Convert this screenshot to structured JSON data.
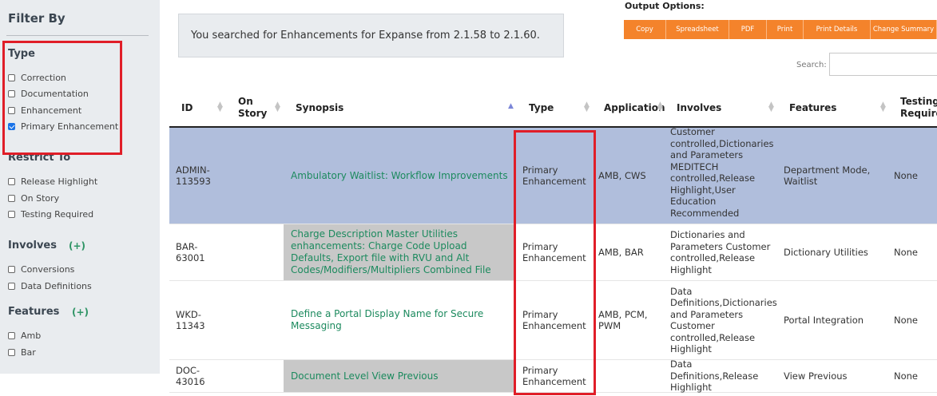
{
  "sidebar": {
    "title": "Filter By",
    "type_section": {
      "heading": "Type",
      "options": [
        {
          "label": "Correction",
          "checked": false
        },
        {
          "label": "Documentation",
          "checked": false
        },
        {
          "label": "Enhancement",
          "checked": false
        },
        {
          "label": "Primary Enhancement",
          "checked": true
        }
      ]
    },
    "restrict_section": {
      "heading": "Restrict To",
      "options": [
        {
          "label": "Release Highlight",
          "checked": false
        },
        {
          "label": "On Story",
          "checked": false
        },
        {
          "label": "Testing Required",
          "checked": false
        }
      ]
    },
    "involves_section": {
      "heading": "Involves",
      "expand": "(+)",
      "options": [
        {
          "label": "Conversions",
          "checked": false
        },
        {
          "label": "Data Definitions",
          "checked": false
        }
      ]
    },
    "features_section": {
      "heading": "Features",
      "expand": "(+)",
      "options": [
        {
          "label": "Amb",
          "checked": false
        },
        {
          "label": "Bar",
          "checked": false
        }
      ]
    }
  },
  "summary": {
    "text": "You searched for Enhancements for Expanse from 2.1.58 to 2.1.60."
  },
  "output": {
    "title": "Output Options:",
    "buttons": [
      "Copy",
      "Spreadsheet",
      "PDF",
      "Print",
      "Print Details",
      "Change Summary"
    ]
  },
  "search": {
    "label": "Search:",
    "value": ""
  },
  "table": {
    "headers": {
      "id": "ID",
      "on_story_1": "On",
      "on_story_2": "Story",
      "synopsis": "Synopsis",
      "type": "Type",
      "application": "Application",
      "involves": "Involves",
      "features": "Features",
      "testing_1": "Testing",
      "testing_2": "Required"
    },
    "rows": [
      {
        "id_1": "ADMIN-",
        "id_2": "113593",
        "synopsis": "Ambulatory Waitlist: Workflow Improvements",
        "type_1": "Primary",
        "type_2": "Enhancement",
        "application": "AMB, CWS",
        "involves": "and Parameters Customer controlled,Dictionaries and Parameters MEDITECH controlled,Release Highlight,User Education Recommended",
        "features": "Department Mode, Waitlist",
        "testing": "None"
      },
      {
        "id_1": "BAR-",
        "id_2": "63001",
        "synopsis": "Charge Description Master Utilities enhancements: Charge Code Upload Defaults, Export file with RVU and Alt Codes/Modifiers/Multipliers Combined File",
        "type_1": "Primary",
        "type_2": "Enhancement",
        "application": "AMB, BAR",
        "involves": "Dictionaries and Parameters Customer controlled,Release Highlight",
        "features": "Dictionary Utilities",
        "testing": "None"
      },
      {
        "id_1": "WKD-",
        "id_2": "11343",
        "synopsis": "Define a Portal Display Name for Secure Messaging",
        "type_1": "Primary",
        "type_2": "Enhancement",
        "application": "AMB, PCM, PWM",
        "involves": "Data Definitions,Dictionaries and Parameters Customer controlled,Release Highlight",
        "features": "Portal Integration",
        "testing": "None"
      },
      {
        "id_1": "DOC-",
        "id_2": "43016",
        "synopsis": "Document Level View Previous",
        "type_1": "Primary",
        "type_2": "Enhancement",
        "application": "",
        "involves": "Data Definitions,Release Highlight",
        "features": "View Previous",
        "testing": "None"
      }
    ]
  },
  "colors": {
    "accent_orange": "#f4832b",
    "link_green": "#1c8a5e",
    "highlight_red": "#e01e28",
    "selected_row": "#b0bedc",
    "sidebar_bg": "#e9ecef"
  }
}
